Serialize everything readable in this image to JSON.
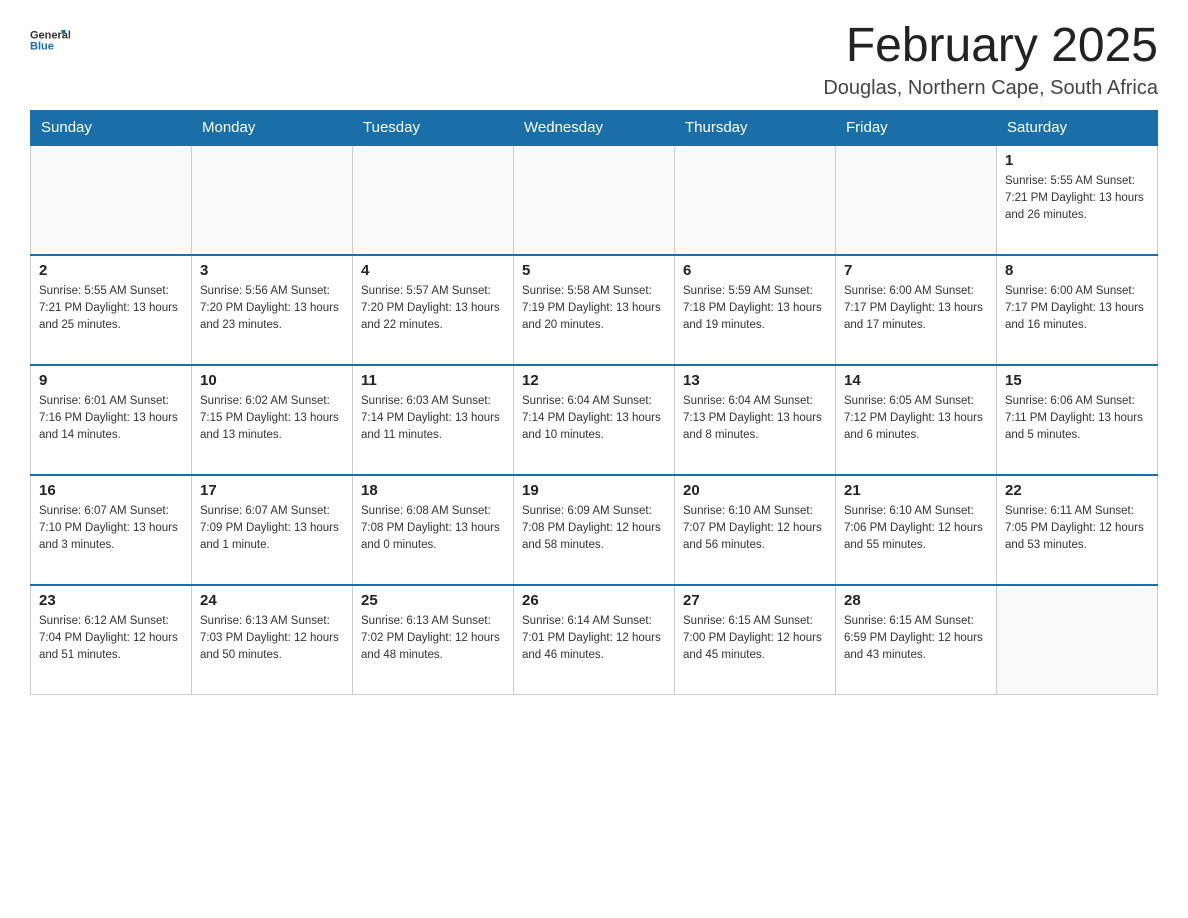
{
  "header": {
    "logo_general": "General",
    "logo_blue": "Blue",
    "month_title": "February 2025",
    "location": "Douglas, Northern Cape, South Africa"
  },
  "days_of_week": [
    "Sunday",
    "Monday",
    "Tuesday",
    "Wednesday",
    "Thursday",
    "Friday",
    "Saturday"
  ],
  "weeks": [
    [
      {
        "day": "",
        "info": ""
      },
      {
        "day": "",
        "info": ""
      },
      {
        "day": "",
        "info": ""
      },
      {
        "day": "",
        "info": ""
      },
      {
        "day": "",
        "info": ""
      },
      {
        "day": "",
        "info": ""
      },
      {
        "day": "1",
        "info": "Sunrise: 5:55 AM\nSunset: 7:21 PM\nDaylight: 13 hours\nand 26 minutes."
      }
    ],
    [
      {
        "day": "2",
        "info": "Sunrise: 5:55 AM\nSunset: 7:21 PM\nDaylight: 13 hours\nand 25 minutes."
      },
      {
        "day": "3",
        "info": "Sunrise: 5:56 AM\nSunset: 7:20 PM\nDaylight: 13 hours\nand 23 minutes."
      },
      {
        "day": "4",
        "info": "Sunrise: 5:57 AM\nSunset: 7:20 PM\nDaylight: 13 hours\nand 22 minutes."
      },
      {
        "day": "5",
        "info": "Sunrise: 5:58 AM\nSunset: 7:19 PM\nDaylight: 13 hours\nand 20 minutes."
      },
      {
        "day": "6",
        "info": "Sunrise: 5:59 AM\nSunset: 7:18 PM\nDaylight: 13 hours\nand 19 minutes."
      },
      {
        "day": "7",
        "info": "Sunrise: 6:00 AM\nSunset: 7:17 PM\nDaylight: 13 hours\nand 17 minutes."
      },
      {
        "day": "8",
        "info": "Sunrise: 6:00 AM\nSunset: 7:17 PM\nDaylight: 13 hours\nand 16 minutes."
      }
    ],
    [
      {
        "day": "9",
        "info": "Sunrise: 6:01 AM\nSunset: 7:16 PM\nDaylight: 13 hours\nand 14 minutes."
      },
      {
        "day": "10",
        "info": "Sunrise: 6:02 AM\nSunset: 7:15 PM\nDaylight: 13 hours\nand 13 minutes."
      },
      {
        "day": "11",
        "info": "Sunrise: 6:03 AM\nSunset: 7:14 PM\nDaylight: 13 hours\nand 11 minutes."
      },
      {
        "day": "12",
        "info": "Sunrise: 6:04 AM\nSunset: 7:14 PM\nDaylight: 13 hours\nand 10 minutes."
      },
      {
        "day": "13",
        "info": "Sunrise: 6:04 AM\nSunset: 7:13 PM\nDaylight: 13 hours\nand 8 minutes."
      },
      {
        "day": "14",
        "info": "Sunrise: 6:05 AM\nSunset: 7:12 PM\nDaylight: 13 hours\nand 6 minutes."
      },
      {
        "day": "15",
        "info": "Sunrise: 6:06 AM\nSunset: 7:11 PM\nDaylight: 13 hours\nand 5 minutes."
      }
    ],
    [
      {
        "day": "16",
        "info": "Sunrise: 6:07 AM\nSunset: 7:10 PM\nDaylight: 13 hours\nand 3 minutes."
      },
      {
        "day": "17",
        "info": "Sunrise: 6:07 AM\nSunset: 7:09 PM\nDaylight: 13 hours\nand 1 minute."
      },
      {
        "day": "18",
        "info": "Sunrise: 6:08 AM\nSunset: 7:08 PM\nDaylight: 13 hours\nand 0 minutes."
      },
      {
        "day": "19",
        "info": "Sunrise: 6:09 AM\nSunset: 7:08 PM\nDaylight: 12 hours\nand 58 minutes."
      },
      {
        "day": "20",
        "info": "Sunrise: 6:10 AM\nSunset: 7:07 PM\nDaylight: 12 hours\nand 56 minutes."
      },
      {
        "day": "21",
        "info": "Sunrise: 6:10 AM\nSunset: 7:06 PM\nDaylight: 12 hours\nand 55 minutes."
      },
      {
        "day": "22",
        "info": "Sunrise: 6:11 AM\nSunset: 7:05 PM\nDaylight: 12 hours\nand 53 minutes."
      }
    ],
    [
      {
        "day": "23",
        "info": "Sunrise: 6:12 AM\nSunset: 7:04 PM\nDaylight: 12 hours\nand 51 minutes."
      },
      {
        "day": "24",
        "info": "Sunrise: 6:13 AM\nSunset: 7:03 PM\nDaylight: 12 hours\nand 50 minutes."
      },
      {
        "day": "25",
        "info": "Sunrise: 6:13 AM\nSunset: 7:02 PM\nDaylight: 12 hours\nand 48 minutes."
      },
      {
        "day": "26",
        "info": "Sunrise: 6:14 AM\nSunset: 7:01 PM\nDaylight: 12 hours\nand 46 minutes."
      },
      {
        "day": "27",
        "info": "Sunrise: 6:15 AM\nSunset: 7:00 PM\nDaylight: 12 hours\nand 45 minutes."
      },
      {
        "day": "28",
        "info": "Sunrise: 6:15 AM\nSunset: 6:59 PM\nDaylight: 12 hours\nand 43 minutes."
      },
      {
        "day": "",
        "info": ""
      }
    ]
  ]
}
